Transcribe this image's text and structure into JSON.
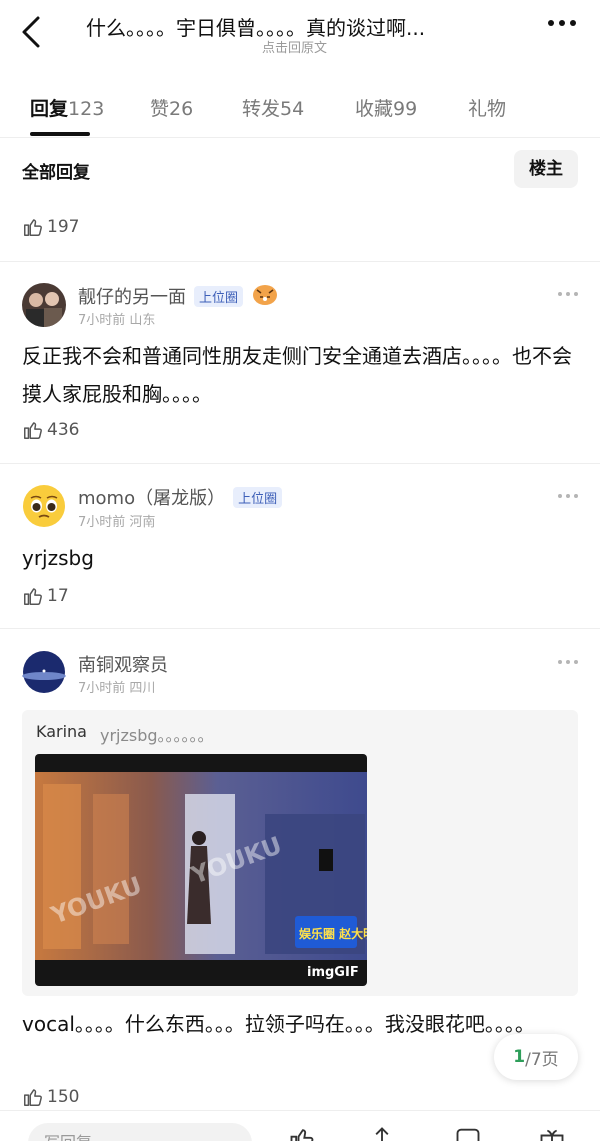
{
  "header": {
    "title": "什么。。。。宇日俱曾。。。。真的谈过啊...",
    "subtitle": "点击回原文"
  },
  "tabs": [
    {
      "label": "回复",
      "count": "123"
    },
    {
      "label": "赞",
      "count": "26"
    },
    {
      "label": "转发",
      "count": "54"
    },
    {
      "label": "收藏",
      "count": "99"
    },
    {
      "label": "礼物",
      "count": ""
    }
  ],
  "section": {
    "title": "全部回复",
    "owner_button": "楼主"
  },
  "first_likes": "197",
  "comments": [
    {
      "username": "靓仔的另一面",
      "badge": "上位圈",
      "time": "7小时前",
      "location": "山东",
      "text": "反正我不会和普通同性朋友走侧门安全通道去酒店。。。。也不会摸人家屁股和胸。。。。",
      "likes": "436"
    },
    {
      "username": "momo（屠龙版）",
      "badge": "上位圈",
      "time": "7小时前",
      "location": "河南",
      "text": "yrjzsbg",
      "likes": "17"
    },
    {
      "username": "南铜观察员",
      "badge": "",
      "time": "7小时前",
      "location": "四川",
      "quote_author": "Karina",
      "quote_text": "yrjzsbg。。。。。。",
      "gif_watermark": "YOUKU",
      "gif_caption": "娱乐圈 赵大明白",
      "gif_tag": "imgGIF",
      "text": "vocal。。。。什么东西。。。拉领子吗在。。。我没眼花吧。。。。",
      "likes": "150"
    }
  ],
  "pager": {
    "current": "1",
    "total": "/7页"
  },
  "bottom_bar": {
    "input_placeholder": "写回复"
  },
  "colors": {
    "badge_text": "#3d5fb8",
    "badge_bg": "#e8eefc",
    "pager_current": "#2e9e5a"
  },
  "icons": {
    "back": "chevron-left-icon",
    "more": "more-dots-icon",
    "like": "thumb-up-icon"
  }
}
